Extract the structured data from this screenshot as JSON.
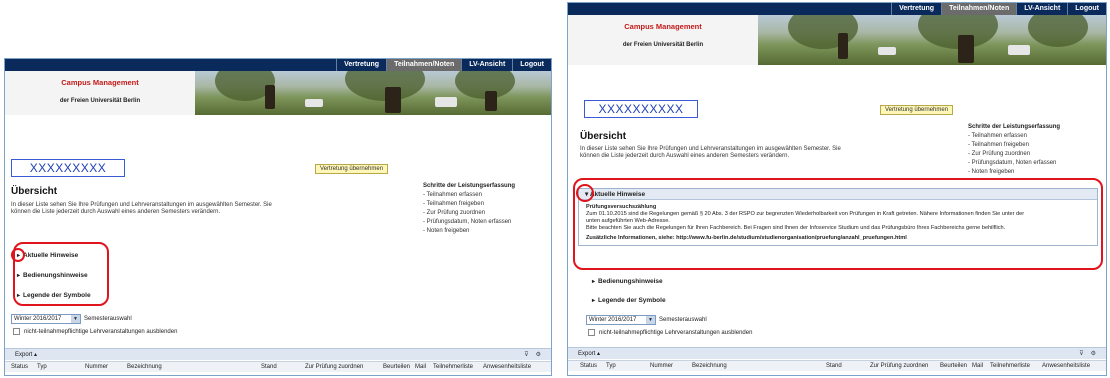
{
  "app": {
    "nav": [
      "Vertretung",
      "Teilnahmen/Noten",
      "LV-Ansicht",
      "Logout"
    ],
    "nav_active_index": 1,
    "brand_title": "Campus Management",
    "brand_subtitle": "der Freien Universität Berlin"
  },
  "page": {
    "name_placeholder": "XXXXXXXXX",
    "name_placeholder_right": "XXXXXXXXXX",
    "takeover_button": "Vertretung übernehmen",
    "title": "Übersicht",
    "intro_line1": "In dieser Liste sehen Sie Ihre Prüfungen und Lehrveranstaltungen im ausgewählten Semester. Sie",
    "intro_line2": "können die Liste jederzeit durch Auswahl eines anderen Semesters verändern.",
    "steps_title": "Schritte der Leistungserfassung",
    "steps": [
      "- Teilnahmen erfassen",
      "- Teilnahmen freigeben",
      "- Zur Prüfung zuordnen",
      "- Prüfungsdatum, Noten erfassen",
      "- Noten freigeben"
    ]
  },
  "accordion": {
    "aktuelle": "Aktuelle Hinweise",
    "bedienung": "Bedienungshinweise",
    "legende": "Legende der Symbole"
  },
  "hinweise_content": {
    "heading": "Prüfungsversuchszählung",
    "line1": "Zum 01.10.2015 sind die Regelungen gemäß § 20 Abs. 3 der RSPO zur begrenzten Wiederholbarkeit von Prüfungen in Kraft getreten. Nähere Informationen finden Sie unter der",
    "line2": "unten aufgeführten Web-Adresse.",
    "line3": "Bitte beachten Sie auch die Regelungen für Ihren Fachbereich. Bei Fragen sind Ihnen der Infoservice Studium und das Prüfungsbüro Ihres Fachbereichs gerne behilflich.",
    "extra": "Zusätzliche Informationen, siehe: http://www.fu-berlin.de/studium/studienorganisation/pruefung/anzahl_pruefungen.html"
  },
  "filters": {
    "semester_value": "Winter 2016/2017",
    "semester_label": "Semesterauswahl",
    "hide_label": "nicht-teilnahmepflichtige Lehrveranstaltungen ausblenden"
  },
  "table": {
    "export_label": "Export ▴",
    "icons": [
      "filter-icon",
      "settings-icon"
    ],
    "columns": [
      "Status",
      "Typ",
      "Nummer",
      "Bezeichnung",
      "Stand",
      "Zur Prüfung zuordnen",
      "Beurteilen",
      "Mail",
      "Teilnehmerliste",
      "Anwesenheitsliste"
    ]
  },
  "colors": {
    "nav_bg": "#0b2a5c",
    "brand_red": "#c41a1a",
    "highlight_red": "#e0141c",
    "name_blue": "#1f3fb5"
  }
}
